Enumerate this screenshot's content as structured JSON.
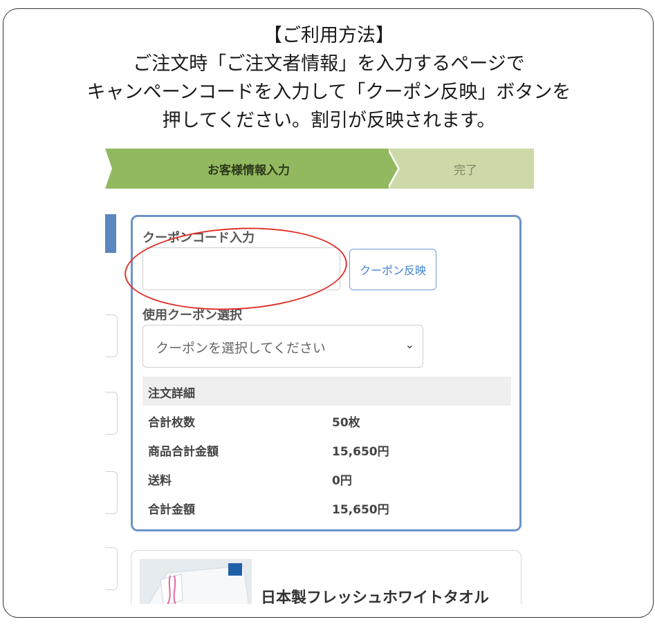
{
  "instructions": {
    "heading": "【ご利用方法】",
    "line1": "ご注文時「ご注文者情報」を入力するページで",
    "line2": "キャンペーンコードを入力して「クーポン反映」ボタンを",
    "line3": "押してください。割引が反映されます。"
  },
  "steps": {
    "active": "お客様情報入力",
    "done": "完了"
  },
  "coupon": {
    "code_label": "クーポンコード入力",
    "code_value": "",
    "apply_button": "クーポン反映",
    "select_label": "使用クーポン選択",
    "select_value": "クーポンを選択してください"
  },
  "order_detail": {
    "title": "注文詳細",
    "rows": [
      {
        "label": "合計枚数",
        "value": "50枚"
      },
      {
        "label": "商品合計金額",
        "value": "15,650円"
      },
      {
        "label": "送料",
        "value": "0円"
      },
      {
        "label": "合計金額",
        "value": "15,650円"
      }
    ]
  },
  "product": {
    "title": "日本製フレッシュホワイトタオル"
  },
  "colors": {
    "step_active": "#93b960",
    "step_done": "#cdd9a8",
    "card_border": "#6b93c6",
    "highlight": "#e0302a"
  }
}
